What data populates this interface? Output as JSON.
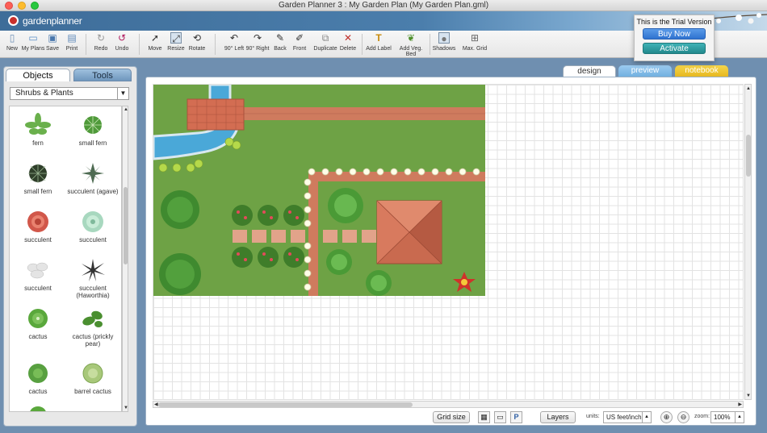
{
  "window": {
    "title": "Garden Planner 3 : My  Garden Plan (My  Garden Plan.gml)"
  },
  "brand": {
    "logo_text": "gardenplanner"
  },
  "trial": {
    "message": "This is the Trial Version",
    "buy_label": "Buy Now",
    "activate_label": "Activate"
  },
  "toolbar": {
    "new": "New",
    "my_plans": "My Plans",
    "save": "Save",
    "print": "Print",
    "redo": "Redo",
    "undo": "Undo",
    "move": "Move",
    "resize": "Resize",
    "rotate": "Rotate",
    "rot_left": "90° Left",
    "rot_right": "90° Right",
    "back": "Back",
    "front": "Front",
    "duplicate": "Duplicate",
    "delete": "Delete",
    "add_label": "Add Label",
    "add_veg_bed": "Add Veg. Bed",
    "shadows": "Shadows",
    "max_grid": "Max. Grid"
  },
  "left_panel": {
    "tabs": {
      "objects": "Objects",
      "tools": "Tools"
    },
    "category": "Shrubs & Plants",
    "plants": [
      {
        "label": "fern",
        "icon": "fern-icon",
        "color": "#6ab04c"
      },
      {
        "label": "small fern",
        "icon": "small-fern-icon",
        "color": "#4f9a3a"
      },
      {
        "label": "small fern",
        "icon": "dark-fern-icon",
        "color": "#2f3f2a"
      },
      {
        "label": "succulent (agave)",
        "icon": "agave-icon",
        "color": "#4e6b52"
      },
      {
        "label": "succulent",
        "icon": "red-succulent-icon",
        "color": "#d1574a"
      },
      {
        "label": "succulent",
        "icon": "green-succulent-icon",
        "color": "#a8d8bf"
      },
      {
        "label": "succulent",
        "icon": "white-succulent-icon",
        "color": "#e4e4e4"
      },
      {
        "label": "succulent (Haworthia)",
        "icon": "haworthia-icon",
        "color": "#333333"
      },
      {
        "label": "cactus",
        "icon": "cactus-icon",
        "color": "#5aa83c"
      },
      {
        "label": "cactus (prickly pear)",
        "icon": "prickly-pear-icon",
        "color": "#4a8f30"
      },
      {
        "label": "cactus",
        "icon": "round-cactus-icon",
        "color": "#58a040"
      },
      {
        "label": "barrel cactus",
        "icon": "barrel-cactus-icon",
        "color": "#a8c87a"
      }
    ]
  },
  "view_tabs": {
    "design": "design",
    "preview": "preview",
    "notebook": "notebook"
  },
  "bottom": {
    "grid_size": "Grid size",
    "layers": "Layers",
    "units_label": "units:",
    "units_value": "US feet/inch",
    "zoom_label": "zoom:",
    "zoom_value": "100%",
    "p_label": "P"
  },
  "colors": {
    "lawn": "#6ea245",
    "brick": "#cf7b5e",
    "water": "#4aa8d8",
    "accent": "#2f72d0"
  }
}
